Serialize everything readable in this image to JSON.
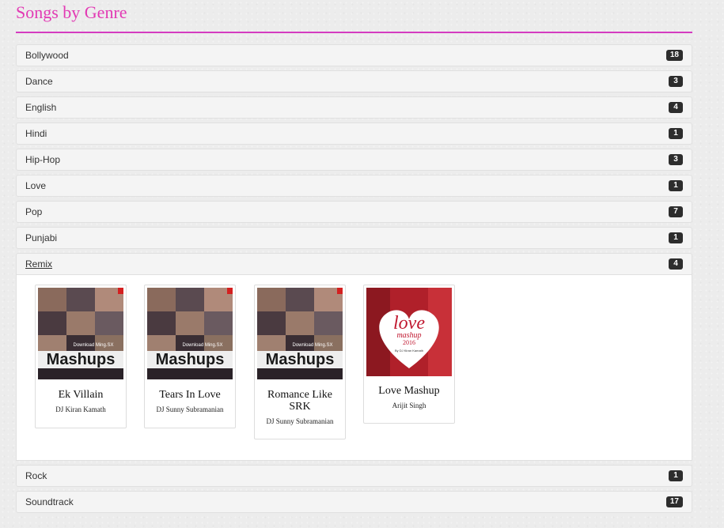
{
  "page": {
    "title": "Songs by Genre"
  },
  "genres": [
    {
      "name": "Bollywood",
      "count": "18"
    },
    {
      "name": "Dance",
      "count": "3"
    },
    {
      "name": "English",
      "count": "4"
    },
    {
      "name": "Hindi",
      "count": "1"
    },
    {
      "name": "Hip-Hop",
      "count": "3"
    },
    {
      "name": "Love",
      "count": "1"
    },
    {
      "name": "Pop",
      "count": "7"
    },
    {
      "name": "Punjabi",
      "count": "1"
    },
    {
      "name": "Remix",
      "count": "4"
    },
    {
      "name": "Rock",
      "count": "1"
    },
    {
      "name": "Soundtrack",
      "count": "17"
    }
  ],
  "remix_songs": [
    {
      "title": "Ek Villain",
      "artist": "DJ Kiran Kamath",
      "art_text": "Mashups",
      "art_sub": "Download Ming.SX"
    },
    {
      "title": "Tears In Love",
      "artist": "DJ Sunny Subramanian",
      "art_text": "Mashups",
      "art_sub": "Download Ming.SX"
    },
    {
      "title": "Romance Like SRK",
      "artist": "DJ Sunny Subramanian",
      "art_text": "Mashups",
      "art_sub": "Download Ming.SX"
    },
    {
      "title": "Love Mashup",
      "artist": "Arijit Singh",
      "art_text": "love",
      "art_sub": "mashup",
      "art_year": "2016",
      "art_credit": "By DJ Kiran Kamath"
    }
  ],
  "colors": {
    "accent": "#e23ab4",
    "badge": "#2d2d2d"
  }
}
